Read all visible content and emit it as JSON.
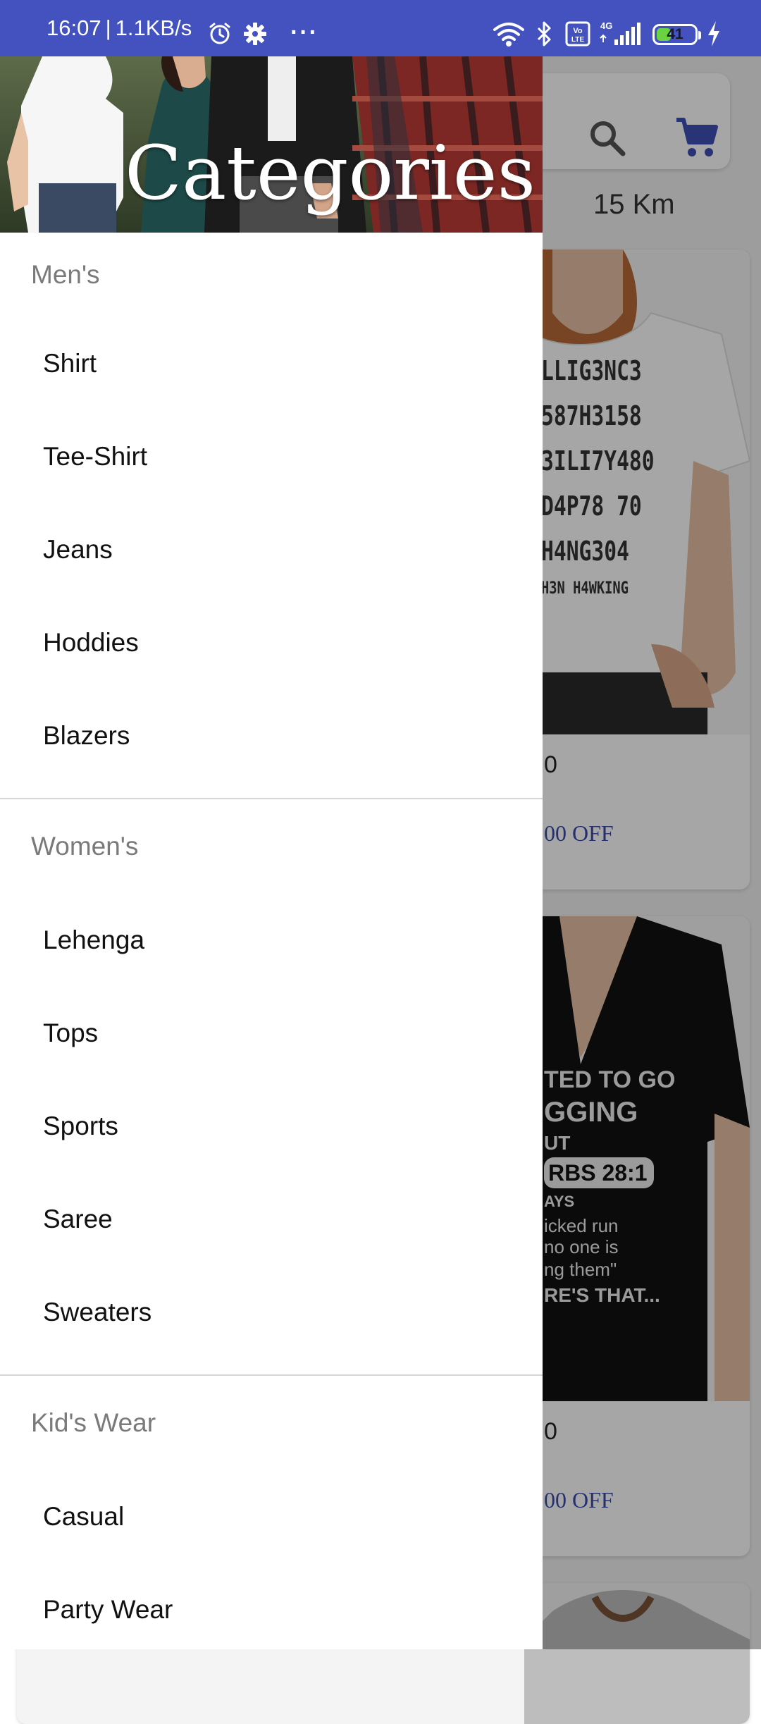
{
  "status_bar": {
    "time": "16:07",
    "separator": "|",
    "speed": "1.1KB/s",
    "more": "···",
    "battery_level": "41",
    "icons": [
      "alarm-icon",
      "settings-icon",
      "wifi-icon",
      "bluetooth-icon",
      "volte-icon",
      "signal-4g-icon",
      "battery-icon",
      "charging-icon"
    ]
  },
  "background": {
    "distance": "15 Km",
    "cards": [
      {
        "title_visible": "0",
        "offer_visible": "00 OFF",
        "tee_lines": [
          "LLIG3NC3",
          "587H3158",
          "3ILI7Y480",
          "D4P78 70",
          "H4NG304",
          "H3N H4WKING"
        ]
      },
      {
        "title_visible": "0",
        "offer_visible": "00 OFF",
        "tee_lines": [
          "TED TO GO",
          "GGING",
          "UT",
          "RBS 28:1",
          "AYS",
          "icked run",
          "no one is",
          "ng them\"",
          "RE'S THAT..."
        ]
      }
    ]
  },
  "drawer": {
    "title": "Categories",
    "sections": [
      {
        "title": "Men's",
        "items": [
          "Shirt",
          "Tee-Shirt",
          "Jeans",
          "Hoddies",
          "Blazers"
        ]
      },
      {
        "title": "Women's",
        "items": [
          "Lehenga",
          "Tops",
          "Sports",
          "Saree",
          "Sweaters"
        ]
      },
      {
        "title": "Kid's Wear",
        "items": [
          "Casual",
          "Party Wear"
        ]
      }
    ]
  },
  "colors": {
    "status_bar": "#4352bf",
    "accent": "#3f51b5",
    "offer_text": "#3a4aa8",
    "section_title": "#7a7a7a",
    "divider": "#d6d6d6"
  }
}
